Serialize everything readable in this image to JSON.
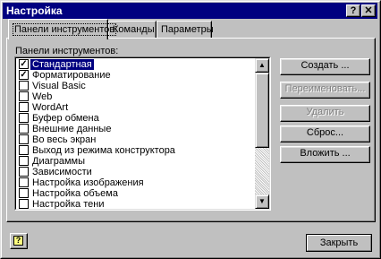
{
  "window": {
    "title": "Настройка",
    "help_glyph": "?",
    "close_glyph": "✕"
  },
  "tabs": [
    {
      "label": "Панели инструментов",
      "active": true
    },
    {
      "label": "Команды",
      "active": false
    },
    {
      "label": "Параметры",
      "active": false
    }
  ],
  "toolbars": {
    "label": "Панели инструментов:",
    "items": [
      {
        "label": "Стандартная",
        "checked": true,
        "selected": true
      },
      {
        "label": "Форматирование",
        "checked": true,
        "selected": false
      },
      {
        "label": "Visual Basic",
        "checked": false,
        "selected": false
      },
      {
        "label": "Web",
        "checked": false,
        "selected": false
      },
      {
        "label": "WordArt",
        "checked": false,
        "selected": false
      },
      {
        "label": "Буфер обмена",
        "checked": false,
        "selected": false
      },
      {
        "label": "Внешние данные",
        "checked": false,
        "selected": false
      },
      {
        "label": "Во весь экран",
        "checked": false,
        "selected": false
      },
      {
        "label": "Выход из режима конструктора",
        "checked": false,
        "selected": false
      },
      {
        "label": "Диаграммы",
        "checked": false,
        "selected": false
      },
      {
        "label": "Зависимости",
        "checked": false,
        "selected": false
      },
      {
        "label": "Настройка изображения",
        "checked": false,
        "selected": false
      },
      {
        "label": "Настройка объема",
        "checked": false,
        "selected": false
      },
      {
        "label": "Настройка тени",
        "checked": false,
        "selected": false
      }
    ]
  },
  "buttons": {
    "create": "Создать ...",
    "rename": "Переименовать...",
    "delete": "Удалить",
    "reset": "Сброс...",
    "attach": "Вложить ..."
  },
  "footer": {
    "help_glyph": "?",
    "close": "Закрыть"
  },
  "scrollbar": {
    "up_glyph": "▲",
    "down_glyph": "▼"
  }
}
